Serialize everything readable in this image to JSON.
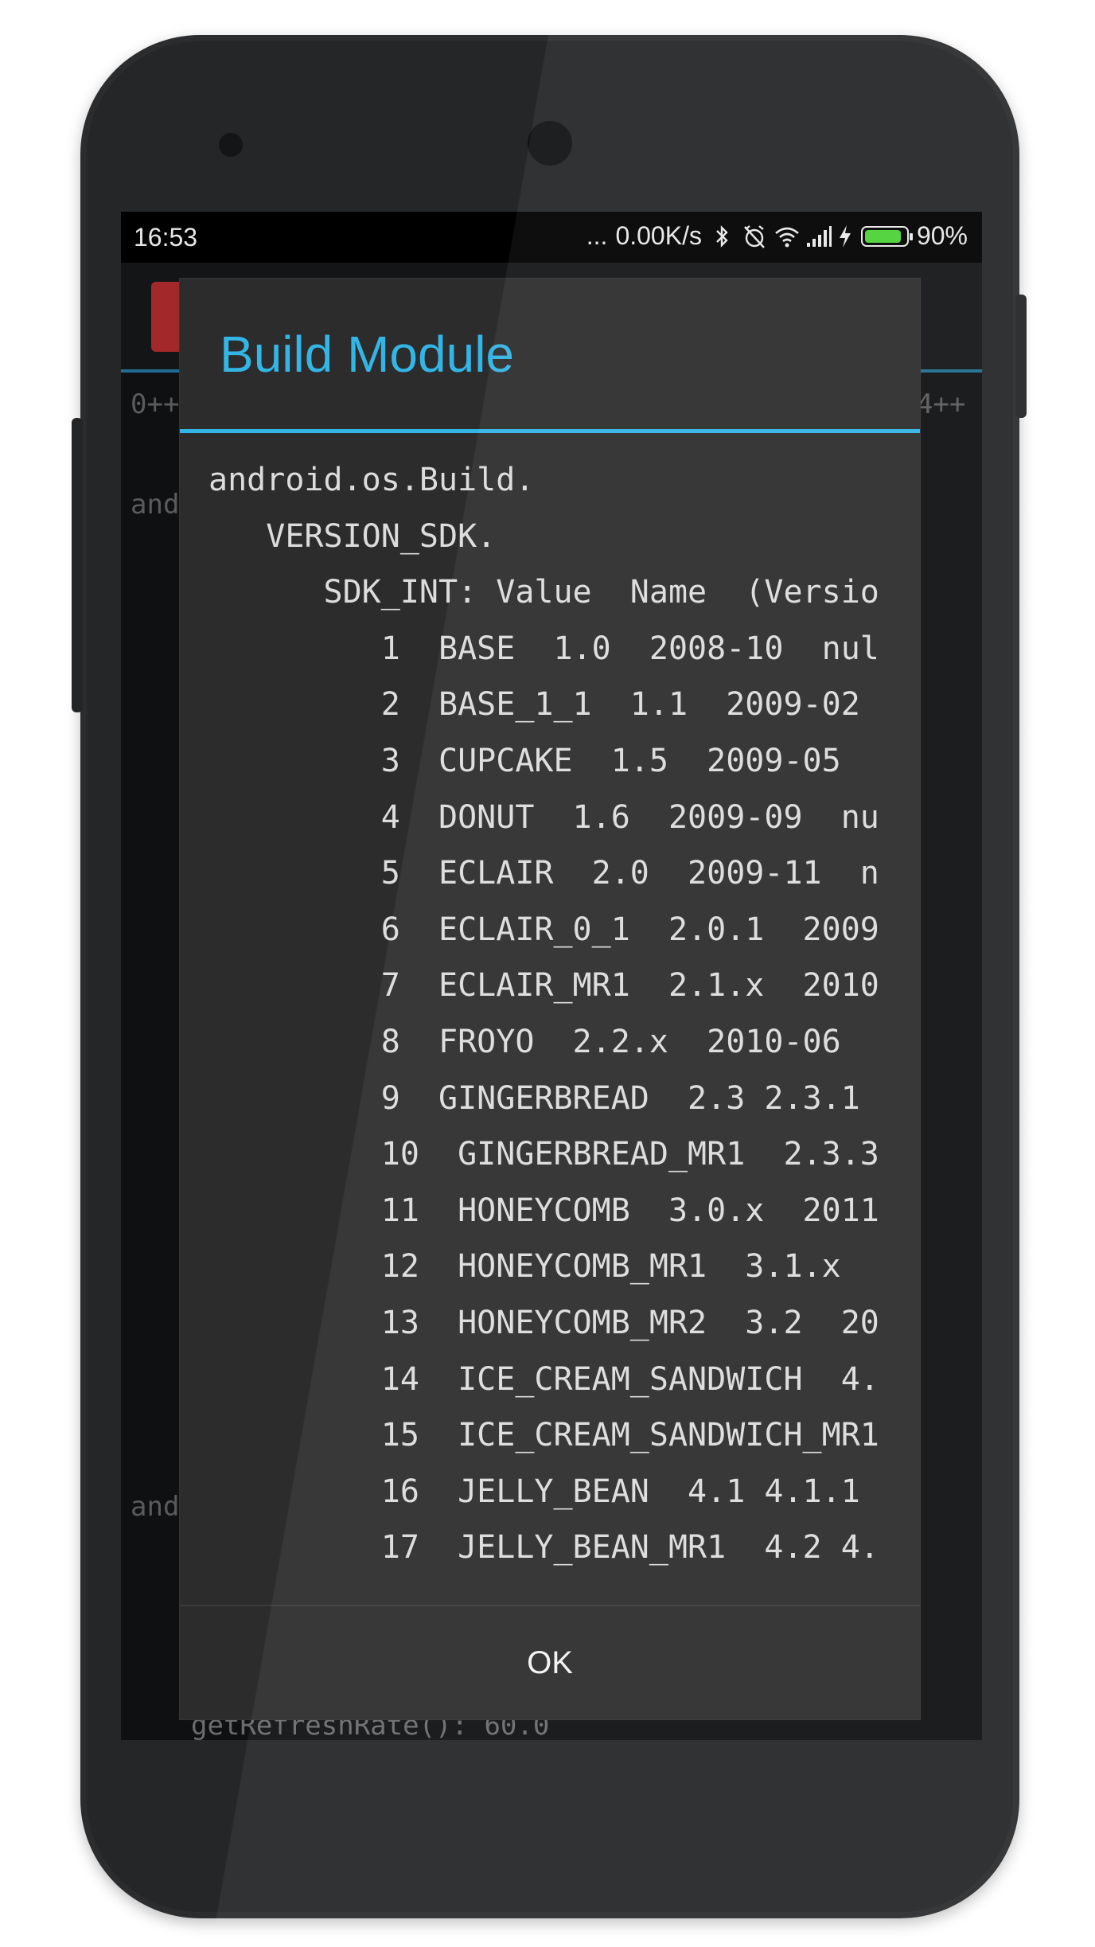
{
  "status_bar": {
    "time": "16:53",
    "dots": "...",
    "network_speed": "0.00K/s",
    "icons": [
      "bluetooth-icon",
      "alarm-off-icon",
      "wifi-icon",
      "signal-icon",
      "charging-icon",
      "battery-icon"
    ],
    "battery_level": 0.9,
    "battery_text": "90%",
    "battery_color": "#4cd137"
  },
  "background": {
    "top_left": "0++",
    "top_right": "4++",
    "line_a": "and",
    "line_b": "and",
    "bottom_line": "getRefreshRate(): 60.0"
  },
  "dialog": {
    "title": "Build Module",
    "accent_color": "#33b5e5",
    "ok_label": "OK",
    "lines": [
      "android.os.Build.",
      "   VERSION_SDK.",
      "      SDK_INT: Value  Name  (Versio",
      "         1  BASE  1.0  2008-10  nul",
      "         2  BASE_1_1  1.1  2009-02",
      "         3  CUPCAKE  1.5  2009-05",
      "         4  DONUT  1.6  2009-09  nu",
      "         5  ECLAIR  2.0  2009-11  n",
      "         6  ECLAIR_0_1  2.0.1  2009",
      "         7  ECLAIR_MR1  2.1.x  2010",
      "         8  FROYO  2.2.x  2010-06",
      "         9  GINGERBREAD  2.3 2.3.1",
      "         10  GINGERBREAD_MR1  2.3.3",
      "         11  HONEYCOMB  3.0.x  2011",
      "         12  HONEYCOMB_MR1  3.1.x",
      "         13  HONEYCOMB_MR2  3.2  20",
      "         14  ICE_CREAM_SANDWICH  4.",
      "         15  ICE_CREAM_SANDWICH_MR1",
      "         16  JELLY_BEAN  4.1 4.1.1",
      "         17  JELLY_BEAN_MR1  4.2 4."
    ]
  }
}
